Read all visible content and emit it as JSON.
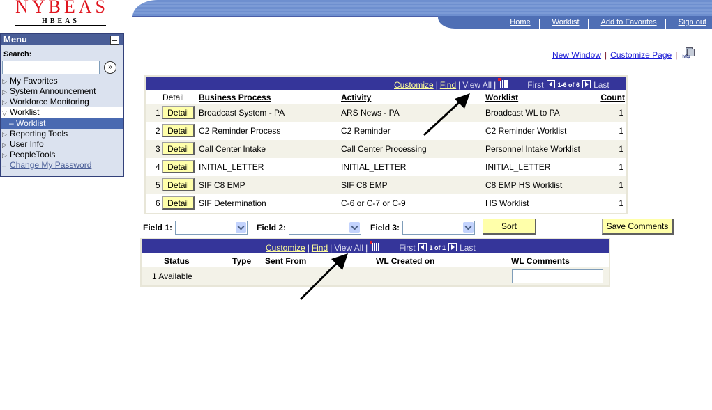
{
  "header": {
    "logo_main": "NYBEAS",
    "logo_sub": "HBEAS",
    "nav_links": [
      "Home",
      "Worklist",
      "Add to Favorites",
      "Sign out"
    ]
  },
  "menu": {
    "title": "Menu",
    "search_label": "Search:",
    "search_value": "",
    "items": [
      {
        "label": "My Favorites",
        "state": "collapsed"
      },
      {
        "label": "System Announcement",
        "state": "collapsed"
      },
      {
        "label": "Workforce Monitoring",
        "state": "collapsed"
      },
      {
        "label": "Worklist",
        "state": "expanded"
      },
      {
        "label": "Worklist",
        "state": "selected"
      },
      {
        "label": "Reporting Tools",
        "state": "collapsed"
      },
      {
        "label": "User Info",
        "state": "collapsed"
      },
      {
        "label": "PeopleTools",
        "state": "collapsed"
      },
      {
        "label": "Change My Password",
        "state": "link"
      }
    ]
  },
  "page_links": {
    "new_window": "New Window",
    "customize_page": "Customize Page",
    "http_icon_label": "http"
  },
  "worklist_grid": {
    "toolbar": {
      "customize": "Customize",
      "find": "Find",
      "view_all": "View All",
      "first": "First",
      "range": "1-6 of 6",
      "last": "Last"
    },
    "columns": [
      "Detail",
      "Business Process",
      "Activity",
      "Worklist",
      "Count"
    ],
    "detail_button_label": "Detail",
    "rows": [
      {
        "num": "1",
        "business_process": "Broadcast System - PA",
        "activity": "ARS News - PA",
        "worklist": "Broadcast WL to PA",
        "count": "1"
      },
      {
        "num": "2",
        "business_process": "C2 Reminder Process",
        "activity": "C2 Reminder",
        "worklist": "C2 Reminder Worklist",
        "count": "1"
      },
      {
        "num": "3",
        "business_process": "Call Center Intake",
        "activity": "Call Center Processing",
        "worklist": "Personnel Intake Worklist",
        "count": "1"
      },
      {
        "num": "4",
        "business_process": "INITIAL_LETTER",
        "activity": "INITIAL_LETTER",
        "worklist": "INITIAL_LETTER",
        "count": "1"
      },
      {
        "num": "5",
        "business_process": "SIF C8 EMP",
        "activity": "SIF C8 EMP",
        "worklist": "C8 EMP HS Worklist",
        "count": "1"
      },
      {
        "num": "6",
        "business_process": "SIF Determination",
        "activity": "C-6 or C-7 or C-9",
        "worklist": "HS Worklist",
        "count": "1"
      }
    ]
  },
  "sort_fields": {
    "field1_label": "Field 1:",
    "field2_label": "Field 2:",
    "field3_label": "Field 3:",
    "field1_value": "",
    "field2_value": "",
    "field3_value": "",
    "sort_button": "Sort",
    "save_comments_button": "Save Comments"
  },
  "status_grid": {
    "toolbar": {
      "customize": "Customize",
      "find": "Find",
      "view_all": "View All",
      "first": "First",
      "range": "1 of 1",
      "last": "Last"
    },
    "columns": [
      "Status",
      "Type",
      "Sent From",
      "WL Created on",
      "WL Comments"
    ],
    "rows": [
      {
        "status": "1 Available",
        "type": "",
        "sent_from": "",
        "wl_created_on": "",
        "wl_comments": ""
      }
    ]
  },
  "colors": {
    "grid_header": "#35359a",
    "menu_header": "#4a5e97",
    "button_bg": "#ffffaa",
    "logo_red": "#e0151f",
    "nav_bar": "#4f6fb5"
  }
}
